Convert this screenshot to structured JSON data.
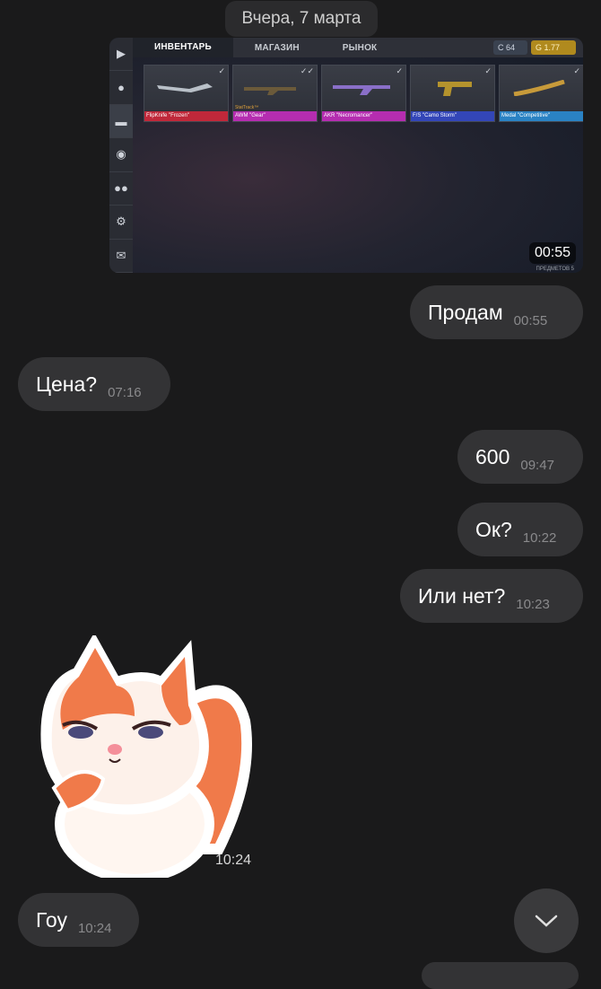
{
  "date_chip": "Вчера, 7 марта",
  "game": {
    "tabs": [
      "ИНВЕНТАРЬ",
      "МАГАЗИН",
      "РЫНОК"
    ],
    "currency_silver": "64",
    "currency_gold": "1.77",
    "items": [
      {
        "label": "FlipKnife \"Frozen\""
      },
      {
        "label": "AWM \"Gear\"",
        "badge": "StatTrack™"
      },
      {
        "label": "AKR \"Necromancer\""
      },
      {
        "label": "F/S \"Camo Storm\""
      },
      {
        "label": "Medal \"Competitive\""
      }
    ],
    "items_count": "ПРЕДМЕТОВ 5"
  },
  "media_time": "00:55",
  "messages": [
    {
      "text": "Продам",
      "time": "00:55"
    },
    {
      "text": "Цена?",
      "time": "07:16"
    },
    {
      "text": "600",
      "time": "09:47"
    },
    {
      "text": "Ок?",
      "time": "10:22"
    },
    {
      "text": "Или нет?",
      "time": "10:23"
    },
    {
      "text": "Гоу",
      "time": "10:24"
    }
  ],
  "sticker_time": "10:24",
  "colors": {
    "background": "#1a1a1b",
    "bubble": "#333335",
    "time_text": "#8a8a8c"
  }
}
